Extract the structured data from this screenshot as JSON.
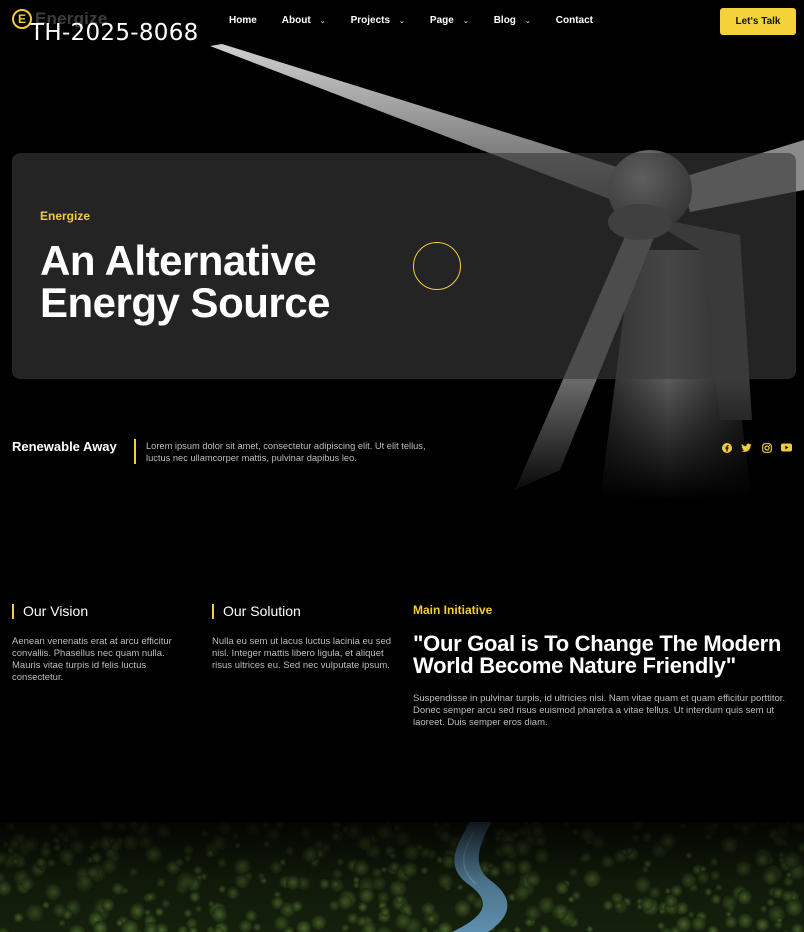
{
  "header": {
    "logo_letter": "E",
    "logo_text": "Energize",
    "watermark": "TH-2025-8068",
    "nav": [
      {
        "label": "Home",
        "has_dropdown": false
      },
      {
        "label": "About",
        "has_dropdown": true
      },
      {
        "label": "Projects",
        "has_dropdown": true
      },
      {
        "label": "Page",
        "has_dropdown": true
      },
      {
        "label": "Blog",
        "has_dropdown": true
      },
      {
        "label": "Contact",
        "has_dropdown": false
      }
    ],
    "cta_label": "Let's Talk"
  },
  "hero": {
    "eyebrow": "Energize",
    "title": "An Alternative\nEnergy Source"
  },
  "sub": {
    "title": "Renewable Away",
    "text": "Lorem ipsum dolor sit amet, consectetur adipiscing elit. Ut elit tellus, luctus nec ullamcorper mattis, pulvinar dapibus leo.",
    "socials": [
      "facebook-icon",
      "twitter-icon",
      "instagram-icon",
      "youtube-icon"
    ]
  },
  "info": {
    "vision": {
      "title": "Our Vision",
      "text": "Aenean venenatis erat at arcu efficitur convallis. Phasellus nec quam nulla. Mauris vitae turpis id felis luctus consectetur."
    },
    "solution": {
      "title": "Our Solution",
      "text": "Nulla eu sem ut lacus luctus lacinia eu sed nisl. Integer mattis libero ligula, et aliquet risus ultrices eu. Sed nec vulputate ipsum."
    },
    "initiative": {
      "eyebrow": "Main Initiative",
      "title": "\"Our Goal is To Change The Modern World Become Nature Friendly\"",
      "text": "Suspendisse in pulvinar turpis, id ultricies nisi. Nam vitae quam et quam efficitur porttitor. Donec semper arcu sed risus euismod pharetra a vitae tellus. Ut interdum quis sem ut laoreet. Duis semper eros diam."
    }
  },
  "colors": {
    "accent": "#f2cc3a",
    "background": "#000000",
    "muted_text": "#bdbdbd"
  }
}
